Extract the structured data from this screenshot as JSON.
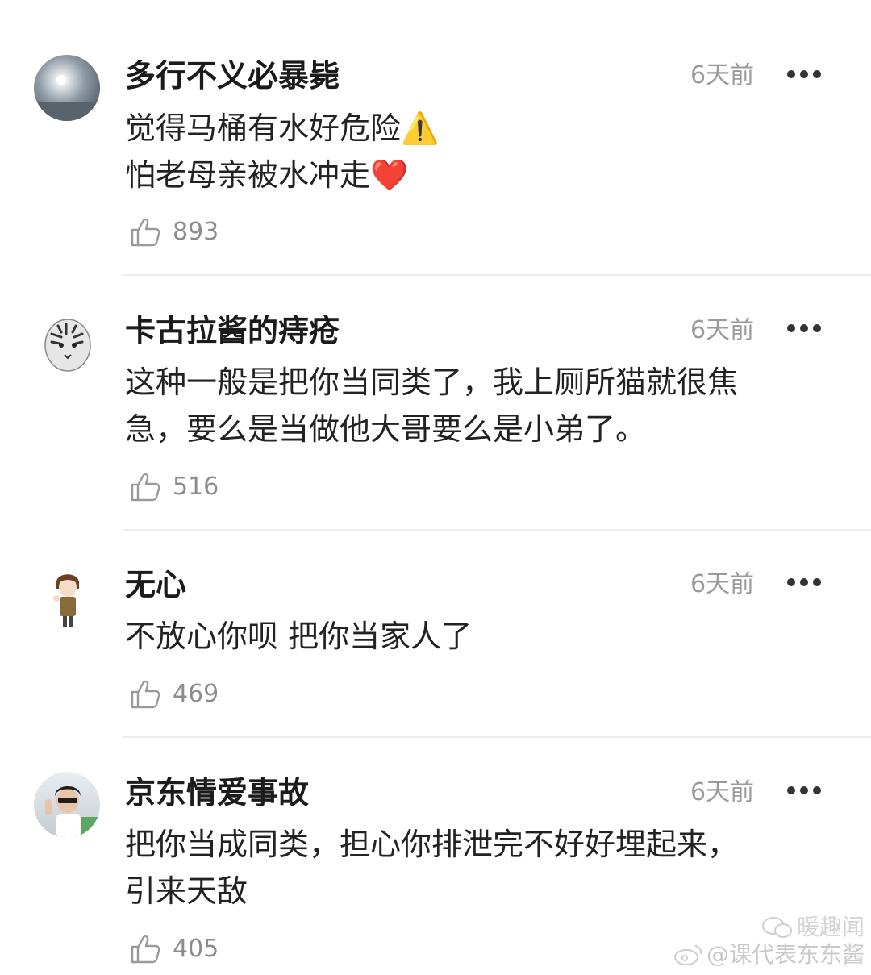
{
  "comments": [
    {
      "username": "多行不义必暴毙",
      "time": "6天前",
      "lines": [
        "觉得马桶有水好危险⚠️",
        "怕老母亲被水冲走❤️"
      ],
      "likes": "893",
      "avatar_icon": "sun-sky-avatar"
    },
    {
      "username": "卡古拉酱的痔疮",
      "time": "6天前",
      "lines": [
        "这种一般是把你当同类了，我上厕所猫就很焦",
        "急，要么是当做他大哥要么是小弟了。"
      ],
      "likes": "516",
      "avatar_icon": "tiger-avatar"
    },
    {
      "username": "无心",
      "time": "6天前",
      "lines": [
        "不放心你呗 把你当家人了"
      ],
      "likes": "469",
      "avatar_icon": "cartoon-boy-avatar"
    },
    {
      "username": "京东情爱事故",
      "time": "6天前",
      "lines": [
        "把你当成同类，担心你排泄完不好好埋起来，",
        "引来天敌"
      ],
      "likes": "405",
      "avatar_icon": "person-photo-avatar"
    }
  ],
  "watermark": {
    "wechat_name": "暖趣闻",
    "weibo_handle": "@课代表东东酱"
  }
}
